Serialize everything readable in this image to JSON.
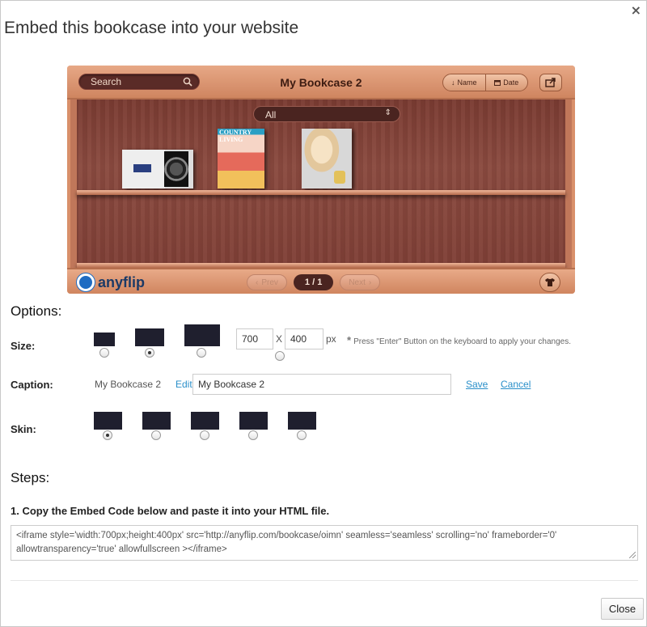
{
  "dialog": {
    "title": "Embed this bookcase into your website",
    "close_icon": "×",
    "close_button": "Close"
  },
  "bookcase": {
    "search_placeholder": "Search",
    "title": "My Bookcase 2",
    "sort_name": "Name",
    "sort_date": "Date",
    "filter": "All",
    "book2_masthead": "COUNTRY LIVING",
    "brand": "anyflip",
    "prev": "Prev",
    "page": "1 / 1",
    "next": "Next"
  },
  "options": {
    "heading": "Options:",
    "size": {
      "label": "Size:",
      "width": "700",
      "height": "400",
      "x": "X",
      "unit": "px",
      "note_star": "*",
      "note": "Press \"Enter\" Button on the keyboard to apply your changes.",
      "selected_preset": 2
    },
    "caption": {
      "label": "Caption:",
      "value": "My Bookcase 2",
      "edit": "Edit",
      "input_value": "My Bookcase 2",
      "save": "Save",
      "cancel": "Cancel"
    },
    "skin": {
      "label": "Skin:",
      "selected": 1,
      "count": 5
    }
  },
  "steps": {
    "heading": "Steps:",
    "step1": "1. Copy the Embed Code below and paste it into your HTML file.",
    "embed_code": "<iframe style='width:700px;height:400px' src='http://anyflip.com/bookcase/oimn'  seamless='seamless' scrolling='no' frameborder='0' allowtransparency='true' allowfullscreen ></iframe>"
  },
  "colors": {
    "swatch": "#1f1f2e",
    "link": "#2a8fc9",
    "shelf_wood": "#7a3b32"
  }
}
